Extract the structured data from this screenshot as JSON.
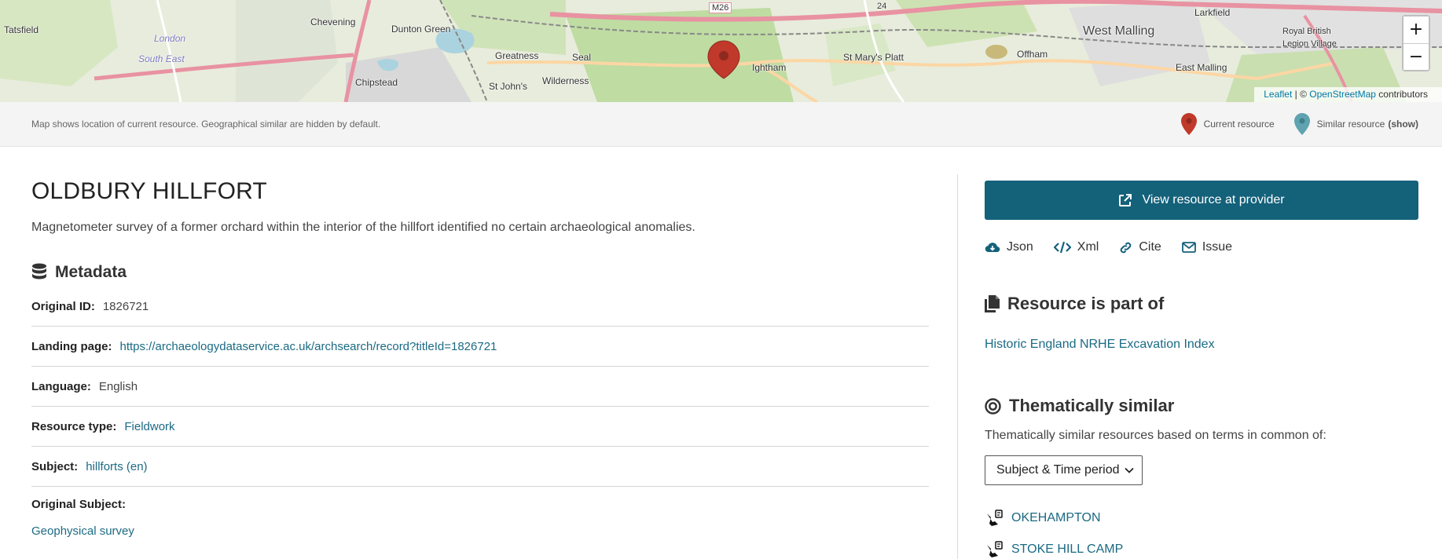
{
  "map": {
    "places": [
      {
        "name": "Tatsfield",
        "cls": ""
      },
      {
        "name": "Chevening",
        "cls": ""
      },
      {
        "name": "London",
        "cls": "italic"
      },
      {
        "name": "South East",
        "cls": "italic"
      },
      {
        "name": "Dunton Green",
        "cls": ""
      },
      {
        "name": "Greatness",
        "cls": ""
      },
      {
        "name": "Seal",
        "cls": ""
      },
      {
        "name": "Chipstead",
        "cls": ""
      },
      {
        "name": "St John's",
        "cls": ""
      },
      {
        "name": "Wilderness",
        "cls": ""
      },
      {
        "name": "Ightham",
        "cls": ""
      },
      {
        "name": "St Mary's Platt",
        "cls": ""
      },
      {
        "name": "Offham",
        "cls": ""
      },
      {
        "name": "West Malling",
        "cls": "big"
      },
      {
        "name": "Larkfield",
        "cls": ""
      },
      {
        "name": "Royal British",
        "cls": "small"
      },
      {
        "name": "Legion Village",
        "cls": "small"
      },
      {
        "name": "East Malling",
        "cls": ""
      },
      {
        "name": "M26",
        "cls": "small"
      },
      {
        "name": "24",
        "cls": "small"
      }
    ],
    "zoom_in": "+",
    "zoom_out": "−",
    "attribution": {
      "leaflet": "Leaflet",
      "sep": " | © ",
      "osm": "OpenStreetMap",
      "suffix": " contributors"
    }
  },
  "note_bar": {
    "text": "Map shows location of current resource. Geographical similar are hidden by default.",
    "current_label": "Current resource",
    "similar_label": "Similar resource",
    "show_label": "(show)",
    "current_color": "#c0392b",
    "similar_color": "#5fa3b0"
  },
  "resource": {
    "title": "OLDBURY HILLFORT",
    "description": "Magnetometer survey of a former orchard within the interior of the hillfort identified no certain archaeological anomalies."
  },
  "metadata": {
    "heading": "Metadata",
    "original_id_label": "Original ID:",
    "original_id": "1826721",
    "landing_label": "Landing page:",
    "landing_url": "https://archaeologydataservice.ac.uk/archsearch/record?titleId=1826721",
    "language_label": "Language:",
    "language": "English",
    "type_label": "Resource type:",
    "type": "Fieldwork",
    "subject_label": "Subject:",
    "subject": "hillforts (en)",
    "orig_subject_label": "Original Subject:",
    "orig_subject": "Geophysical survey"
  },
  "sidebar": {
    "provider_button": "View resource at provider",
    "actions": {
      "json": "Json",
      "xml": "Xml",
      "cite": "Cite",
      "issue": "Issue"
    },
    "part_of_heading": "Resource is part of",
    "part_of_link": "Historic England NRHE Excavation Index",
    "similar_heading": "Thematically similar",
    "similar_text": "Thematically similar resources based on terms in common of:",
    "select_value": "Subject & Time period",
    "similar_items": [
      "OKEHAMPTON",
      "STOKE HILL CAMP"
    ],
    "accent_color": "#14617a"
  }
}
